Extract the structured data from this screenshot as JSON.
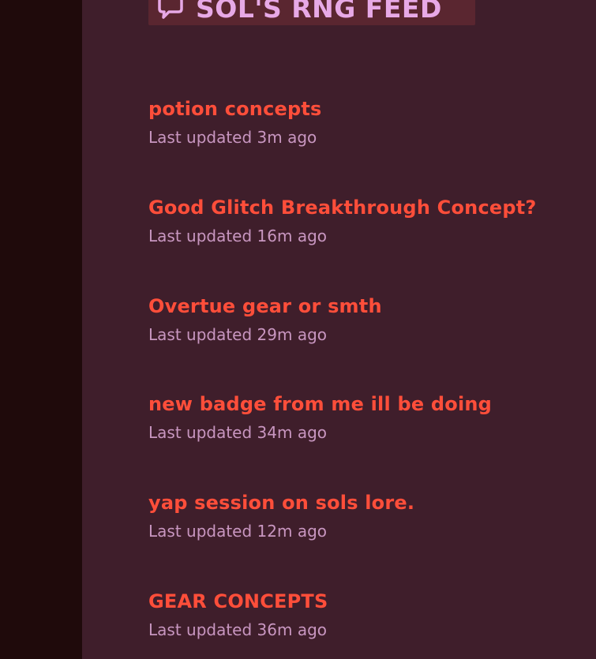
{
  "header": {
    "title": "SOL'S RNG FEED",
    "icon": "chat-bubble-icon"
  },
  "colors": {
    "page_bg": "#1f0a0b",
    "panel_bg": "#3f1e2b",
    "header_bg": "#5a2630",
    "title_text": "#e7a9e6",
    "item_title": "#ff4e3a",
    "item_meta": "#c896c0"
  },
  "feed": {
    "items": [
      {
        "title": "potion concepts",
        "meta": "Last updated 3m ago"
      },
      {
        "title": "Good Glitch Breakthrough Concept?",
        "meta": "Last updated 16m ago"
      },
      {
        "title": "Overtue gear or smth",
        "meta": "Last updated 29m ago"
      },
      {
        "title": "new badge from me ill be doing",
        "meta": "Last updated 34m ago"
      },
      {
        "title": "yap session on sols lore.",
        "meta": "Last updated 12m ago"
      },
      {
        "title": "GEAR CONCEPTS",
        "meta": "Last updated 36m ago"
      }
    ]
  }
}
